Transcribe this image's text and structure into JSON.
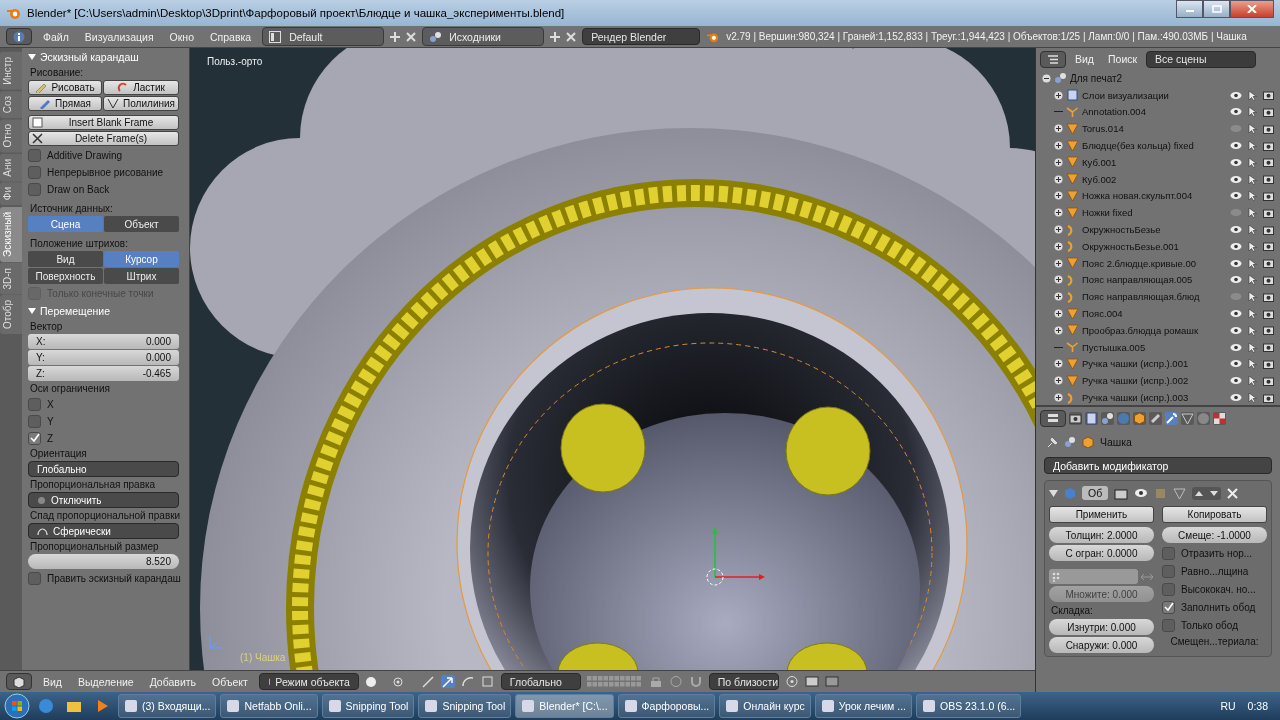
{
  "window": {
    "title": "Blender* [C:\\Users\\admin\\Desktop\\3Dprint\\Фарфоровый проект\\Блюдце и чашка_эксперименты.blend]"
  },
  "info_header": {
    "menu": [
      "Файл",
      "Визуализация",
      "Окно",
      "Справка"
    ],
    "screen_layout": "Default",
    "scene": "Исходники",
    "render_engine": "Рендер Blender",
    "stats": "v2.79 | Вершин:980,324 | Граней:1,152,833 | Треуг.:1,944,423 | Объектов:1/25 | Ламп:0/0 | Пам.:490.03МБ | Чашка"
  },
  "tool_tabs": [
    {
      "label": "Инстр",
      "selected": false
    },
    {
      "label": "Соз",
      "selected": false
    },
    {
      "label": "Отно",
      "selected": false
    },
    {
      "label": "Ани",
      "selected": false
    },
    {
      "label": "Фи",
      "selected": false
    },
    {
      "label": "Эскизный",
      "selected": true
    },
    {
      "label": "3D-п",
      "selected": false
    },
    {
      "label": "Отобр",
      "selected": false
    }
  ],
  "grease_pencil_panel": {
    "title": "Эскизный карандаш",
    "draw_label": "Рисование:",
    "draw_tools": [
      {
        "label": "Рисовать",
        "kind": "pencil"
      },
      {
        "label": "Ластик",
        "kind": "eraser"
      },
      {
        "label": "Прямая",
        "kind": "line"
      },
      {
        "label": "Полилиния",
        "kind": "poly"
      }
    ],
    "frame_buttons": [
      {
        "label": "Insert Blank Frame",
        "kind": "insert"
      },
      {
        "label": "Delete Frame(s)",
        "kind": "delete"
      }
    ],
    "options": [
      {
        "label": "Additive Drawing",
        "checked": false
      },
      {
        "label": "Непрерывное рисование",
        "checked": false
      },
      {
        "label": "Draw on Back",
        "checked": false
      }
    ],
    "data_source": {
      "label": "Источник данных:",
      "options": [
        {
          "label": "Сцена",
          "selected": true
        },
        {
          "label": "Объект",
          "selected": false
        }
      ]
    },
    "stroke_placement": {
      "label": "Положение штрихов:",
      "options": [
        {
          "label": "Вид",
          "selected": false
        },
        {
          "label": "Курсор",
          "selected": true
        },
        {
          "label": "Поверхность",
          "selected": false
        },
        {
          "label": "Штрих",
          "selected": false
        }
      ]
    },
    "endpoints_only": {
      "label": "Только конечные точки",
      "checked": false,
      "disabled": true
    }
  },
  "operator_panel": {
    "title": "Перемещение",
    "vector_label": "Вектор",
    "vector": [
      {
        "label": "X:",
        "value": "0.000"
      },
      {
        "label": "Y:",
        "value": "0.000"
      },
      {
        "label": "Z:",
        "value": "-0.465"
      }
    ],
    "axes_label": "Оси ограничения",
    "axes": [
      {
        "label": "X",
        "checked": false
      },
      {
        "label": "Y",
        "checked": false
      },
      {
        "label": "Z",
        "checked": true
      }
    ],
    "selects": [
      {
        "label": "Ориентация",
        "value": "Глобально",
        "kind": "plain"
      },
      {
        "label": "Пропорциональная правка",
        "value": "Отключить",
        "kind": "dot"
      },
      {
        "label": "Спад пропорциональной правки",
        "value": "Сферически",
        "kind": "arc"
      }
    ],
    "size": {
      "label": "Пропорциональный размер",
      "value": "8.520"
    },
    "edit_grease_pencil": {
      "label": "Править эскизный карандаш",
      "checked": false
    }
  },
  "viewport": {
    "view_label": "Польз.-орто",
    "object_label": "(1) Чашка"
  },
  "outliner": {
    "menu": [
      "Вид",
      "Поиск"
    ],
    "filter": "Все сцены",
    "scene": "Для печат2",
    "items": [
      {
        "name": "Слои визуализации",
        "kind": "layers",
        "visible": true
      },
      {
        "name": "Annotation.004",
        "kind": "empty",
        "visible": true
      },
      {
        "name": "Torus.014",
        "kind": "mesh",
        "visible": false
      },
      {
        "name": "Блюдце(без кольца) fixed",
        "kind": "mesh",
        "visible": true
      },
      {
        "name": "Куб.001",
        "kind": "mesh",
        "visible": true
      },
      {
        "name": "Куб.002",
        "kind": "mesh",
        "visible": true
      },
      {
        "name": "Ножка новая.скульпт.004",
        "kind": "mesh",
        "visible": true
      },
      {
        "name": "Ножки fixed",
        "kind": "mesh",
        "visible": false
      },
      {
        "name": "ОкружностьБезье",
        "kind": "curve",
        "visible": true
      },
      {
        "name": "ОкружностьБезье.001",
        "kind": "curve",
        "visible": true
      },
      {
        "name": "Пояс 2.блюдце.кривые.00",
        "kind": "mesh",
        "visible": true
      },
      {
        "name": "Пояс направляющая.005",
        "kind": "curve",
        "visible": true
      },
      {
        "name": "Пояс направляющая.блюд",
        "kind": "curve",
        "visible": false
      },
      {
        "name": "Пояс.004",
        "kind": "mesh",
        "visible": true
      },
      {
        "name": "Прообраз.блюдца ромашк",
        "kind": "mesh",
        "visible": true
      },
      {
        "name": "Пустышка.005",
        "kind": "empty",
        "visible": true
      },
      {
        "name": "Ручка чашки (испр.).001",
        "kind": "mesh",
        "visible": true
      },
      {
        "name": "Ручка чашки (испр.).002",
        "kind": "mesh",
        "visible": true
      },
      {
        "name": "Ручка чашки (испр.).003",
        "kind": "curve",
        "visible": true
      }
    ]
  },
  "properties": {
    "object": "Чашка",
    "add_modifier": "Добавить модификатор",
    "modifier_name": "Об",
    "buttons": [
      "Применить",
      "Копировать"
    ],
    "left_fields": [
      {
        "label": "Толщин:",
        "value": "2.0000"
      },
      {
        "label": "С огран:",
        "value": "0.0000"
      }
    ],
    "offset": {
      "label": "Смеще:",
      "value": "-1.0000"
    },
    "multiplier": {
      "label": "Множите:",
      "value": "0.000",
      "disabled": true
    },
    "crease_label": "Складка:",
    "crease_fields": [
      {
        "label": "Изнутри:",
        "value": "0.000"
      },
      {
        "label": "Снаружи:",
        "value": "0.000"
      }
    ],
    "checks": [
      {
        "label": "Отразить нор...",
        "checked": false
      },
      {
        "label": "Равно...лщина",
        "checked": false
      },
      {
        "label": "Высококач. но...",
        "checked": false
      },
      {
        "label": "Заполнить обод",
        "checked": true
      },
      {
        "label": "Только обод",
        "checked": false
      }
    ],
    "material_offset_label": "Смещен...териала:"
  },
  "view3d_header": {
    "menu": [
      "Вид",
      "Выделение",
      "Добавить",
      "Объект"
    ],
    "mode": "Режим объекта",
    "orientation": "Глобально",
    "snap": "По близости"
  },
  "taskbar": {
    "items": [
      {
        "label": "(3) Входящи...",
        "selected": false
      },
      {
        "label": "Netfabb Onli...",
        "selected": false
      },
      {
        "label": "Snipping Tool",
        "selected": false
      },
      {
        "label": "Snipping Tool",
        "selected": false
      },
      {
        "label": "Blender* [C:\\...",
        "selected": true
      },
      {
        "label": "Фарфоровы...",
        "selected": false
      },
      {
        "label": "Онлайн курс",
        "selected": false
      },
      {
        "label": "Урок лечим ...",
        "selected": false
      },
      {
        "label": "OBS 23.1.0 (6...",
        "selected": false
      }
    ],
    "language": "RU",
    "clock": "0:38"
  }
}
